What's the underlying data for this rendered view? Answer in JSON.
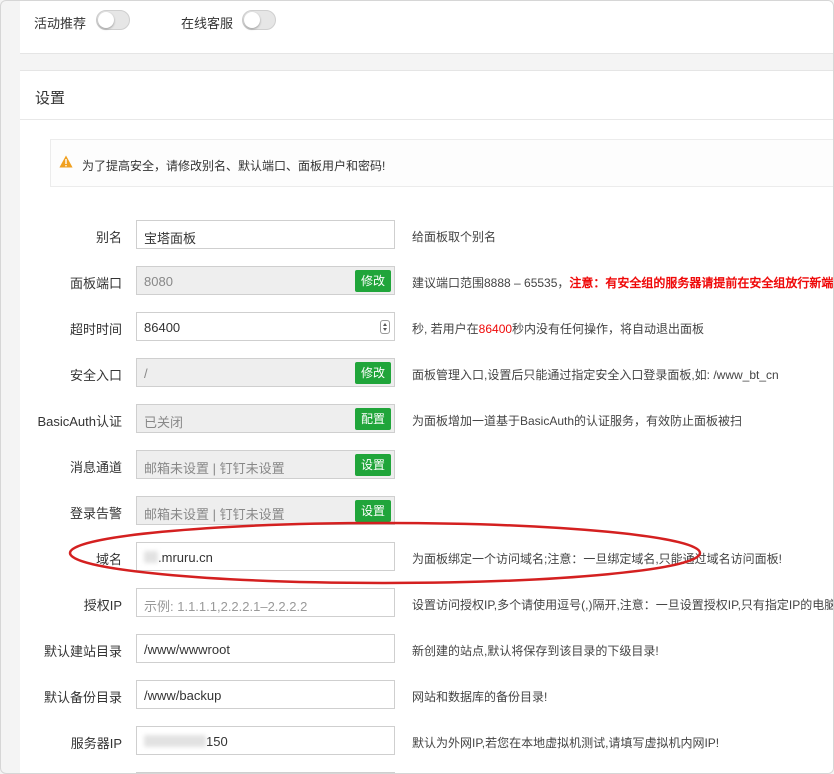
{
  "toggles": [
    {
      "label": "活动推荐",
      "on": false
    },
    {
      "label": "在线客服",
      "on": false
    }
  ],
  "settings": {
    "title": "设置",
    "alert": "为了提高安全，请修改别名、默认端口、面板用户和密码!",
    "rows": [
      {
        "label": "别名",
        "value": "宝塔面板",
        "hint": "给面板取个别名"
      },
      {
        "label": "面板端口",
        "value": "8080",
        "button": "修改",
        "hint_prefix": "建议端口范围8888 – 65535，",
        "hint_warning": "注意：有安全组的服务器请提前在安全组放行新端"
      },
      {
        "label": "超时时间",
        "value": "86400",
        "hint_before": "秒, 若用户在",
        "hint_value": "86400",
        "hint_after": "秒内没有任何操作，将自动退出面板"
      },
      {
        "label": "安全入口",
        "value": "/",
        "button": "修改",
        "hint": "面板管理入口,设置后只能通过指定安全入口登录面板,如: /www_bt_cn"
      },
      {
        "label": "BasicAuth认证",
        "value": "已关闭",
        "button": "配置",
        "hint": "为面板增加一道基于BasicAuth的认证服务，有效防止面板被扫"
      },
      {
        "label": "消息通道",
        "value": "邮箱未设置 | 钉钉未设置",
        "button": "设置",
        "hint": ""
      },
      {
        "label": "登录告警",
        "value": "邮箱未设置 | 钉钉未设置",
        "button": "设置",
        "hint": ""
      },
      {
        "label": "域名",
        "value": ".mruru.cn",
        "hint": "为面板绑定一个访问域名;注意：一旦绑定域名,只能通过域名访问面板!"
      },
      {
        "label": "授权IP",
        "placeholder": "示例: 1.1.1.1,2.2.2.1–2.2.2.2",
        "hint": "设置访问授权IP,多个请使用逗号(,)隔开,注意：一旦设置授权IP,只有指定IP的电脑"
      },
      {
        "label": "默认建站目录",
        "value": "/www/wwwroot",
        "hint": "新创建的站点,默认将保存到该目录的下级目录!"
      },
      {
        "label": "默认备份目录",
        "value": "/www/backup",
        "hint": "网站和数据库的备份目录!"
      },
      {
        "label": "服务器IP",
        "value": "150",
        "hint": "默认为外网IP,若您在本地虚拟机测试,请填写虚拟机内网IP!"
      }
    ]
  },
  "colors": {
    "accent": "#20a53a",
    "warning_red": "#ef0808",
    "annotation": "#d42020",
    "alert_icon": "#f0a020"
  },
  "icons": [
    "warning-icon",
    "spinner-arrows-icon"
  ]
}
